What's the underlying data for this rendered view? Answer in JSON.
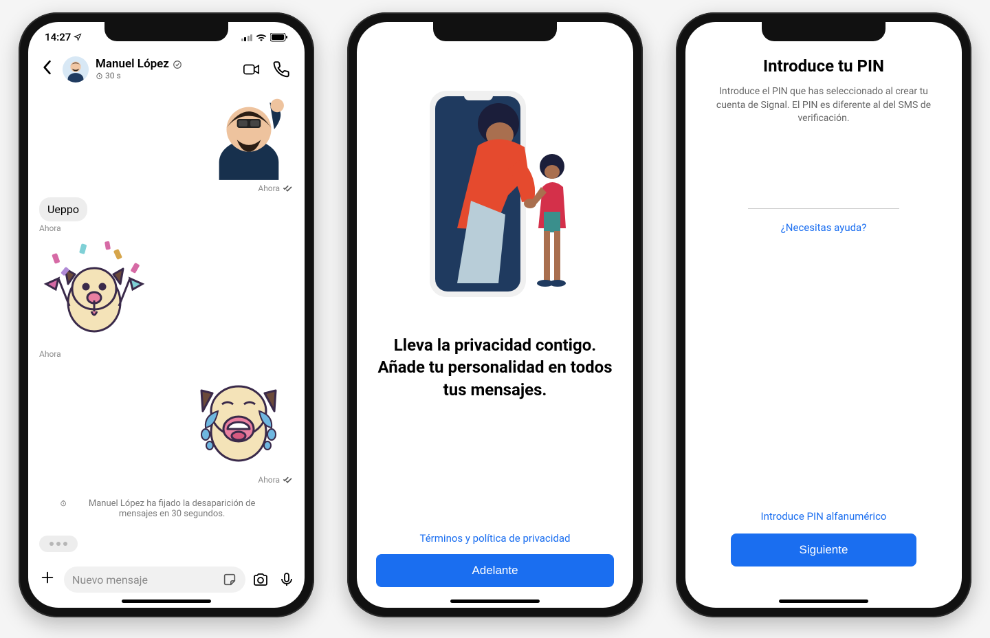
{
  "phone1": {
    "status": {
      "time": "14:27"
    },
    "header": {
      "contact_name": "Manuel López",
      "timer_label": "30 s"
    },
    "messages": {
      "sticker1_ts": "Ahora",
      "text1": "Ueppo",
      "text1_ts": "Ahora",
      "sticker2_ts": "Ahora",
      "sticker3_ts": "Ahora"
    },
    "system_notice": "Manuel López ha fijado la desaparición de mensajes en 30 segundos.",
    "input_placeholder": "Nuevo mensaje"
  },
  "phone2": {
    "headline": "Lleva la privacidad contigo. Añade tu personalidad en todos tus mensajes.",
    "terms_link": "Términos y política de privacidad",
    "cta": "Adelante"
  },
  "phone3": {
    "title": "Introduce tu PIN",
    "description": "Introduce el PIN que has seleccionado al crear tu cuenta de Signal. El PIN es diferente al del SMS de verificación.",
    "help_link": "¿Necesitas ayuda?",
    "alt_link": "Introduce PIN alfanumérico",
    "cta": "Siguiente"
  },
  "colors": {
    "accent": "#1a6ef0"
  }
}
